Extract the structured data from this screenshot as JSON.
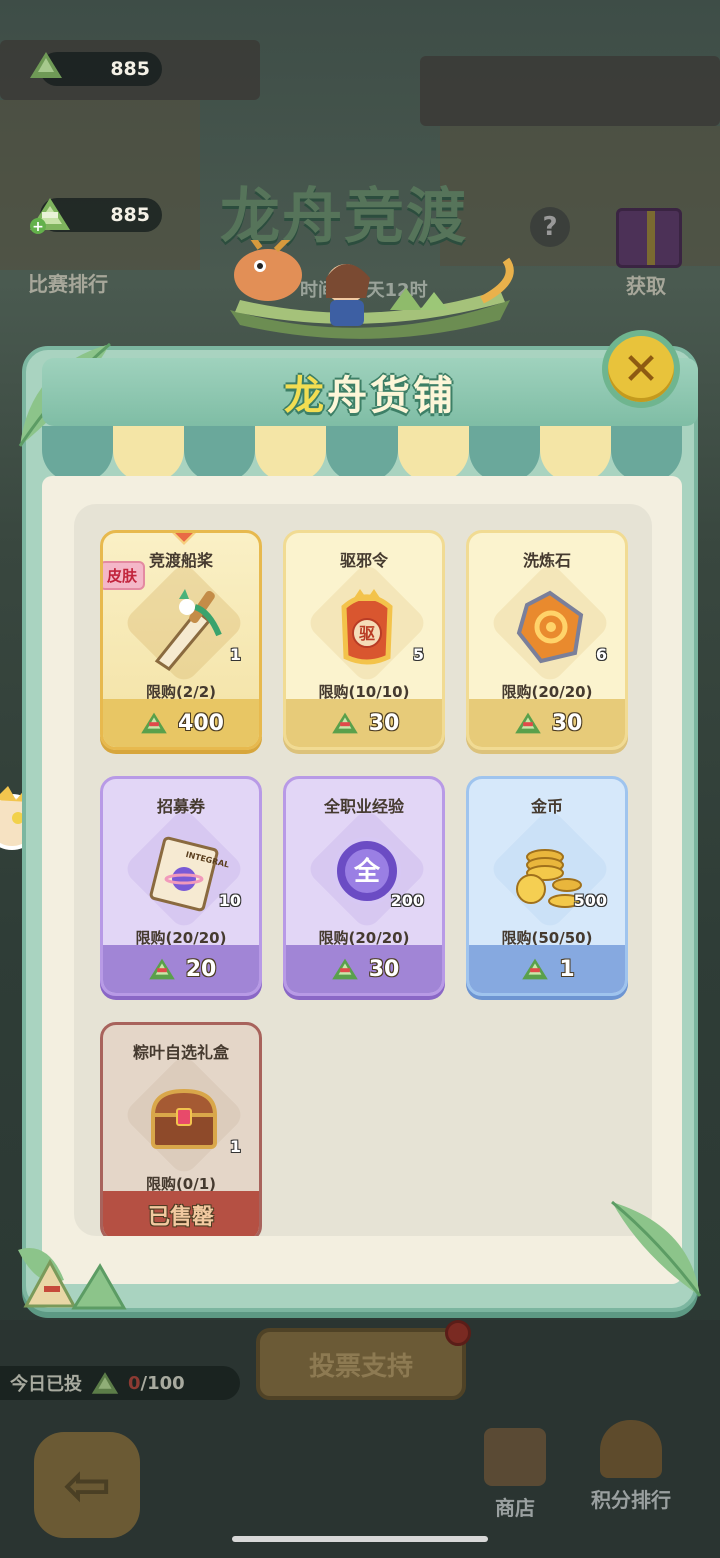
{
  "background": {
    "currency_top": "885",
    "currency_main": "885",
    "event_title": "龙舟竞渡",
    "countdown_text": "时间：2天12时",
    "ranking_label": "比赛排行",
    "obtain_label": "获取",
    "help_label": "?",
    "vote_button": "投票支持",
    "today_label": "今日已投",
    "today_count": "0",
    "today_total": "/100",
    "back_icon": "arrow-left-icon",
    "nav_shop": "商店",
    "nav_points_ranking": "积分排行"
  },
  "shop": {
    "title_first": "龙",
    "title_rest": "舟货铺",
    "close_label": "✕",
    "price_icon": "zongzi-icon",
    "items": [
      {
        "name": "竞渡船桨",
        "qty": "1",
        "limit": "限购(2/2)",
        "price": "400",
        "badge": "皮肤",
        "style": "gold",
        "icon": "oar-icon"
      },
      {
        "name": "驱邪令",
        "qty": "5",
        "limit": "限购(10/10)",
        "price": "30",
        "style": "yellow",
        "icon": "talisman-icon"
      },
      {
        "name": "洗炼石",
        "qty": "6",
        "limit": "限购(20/20)",
        "price": "30",
        "style": "yellow",
        "icon": "refine-stone-icon"
      },
      {
        "name": "招募券",
        "qty": "10",
        "limit": "限购(20/20)",
        "price": "20",
        "style": "purple",
        "icon": "recruit-ticket-icon"
      },
      {
        "name": "全职业经验",
        "qty": "200",
        "limit": "限购(20/20)",
        "price": "30",
        "style": "purple",
        "icon": "exp-orb-icon",
        "icon_text": "全"
      },
      {
        "name": "金币",
        "qty": "500",
        "limit": "限购(50/50)",
        "price": "1",
        "style": "blue",
        "icon": "gold-coins-icon"
      },
      {
        "name": "粽叶自选礼盒",
        "qty": "1",
        "limit": "限购(0/1)",
        "price": "已售罄",
        "style": "red",
        "icon": "treasure-chest-icon"
      }
    ]
  },
  "colors": {
    "panel_green": "#a9d3c0",
    "gold_card": "#f3e2a4",
    "purple_card": "#e2d6f6",
    "blue_card": "#d6e8fa"
  }
}
